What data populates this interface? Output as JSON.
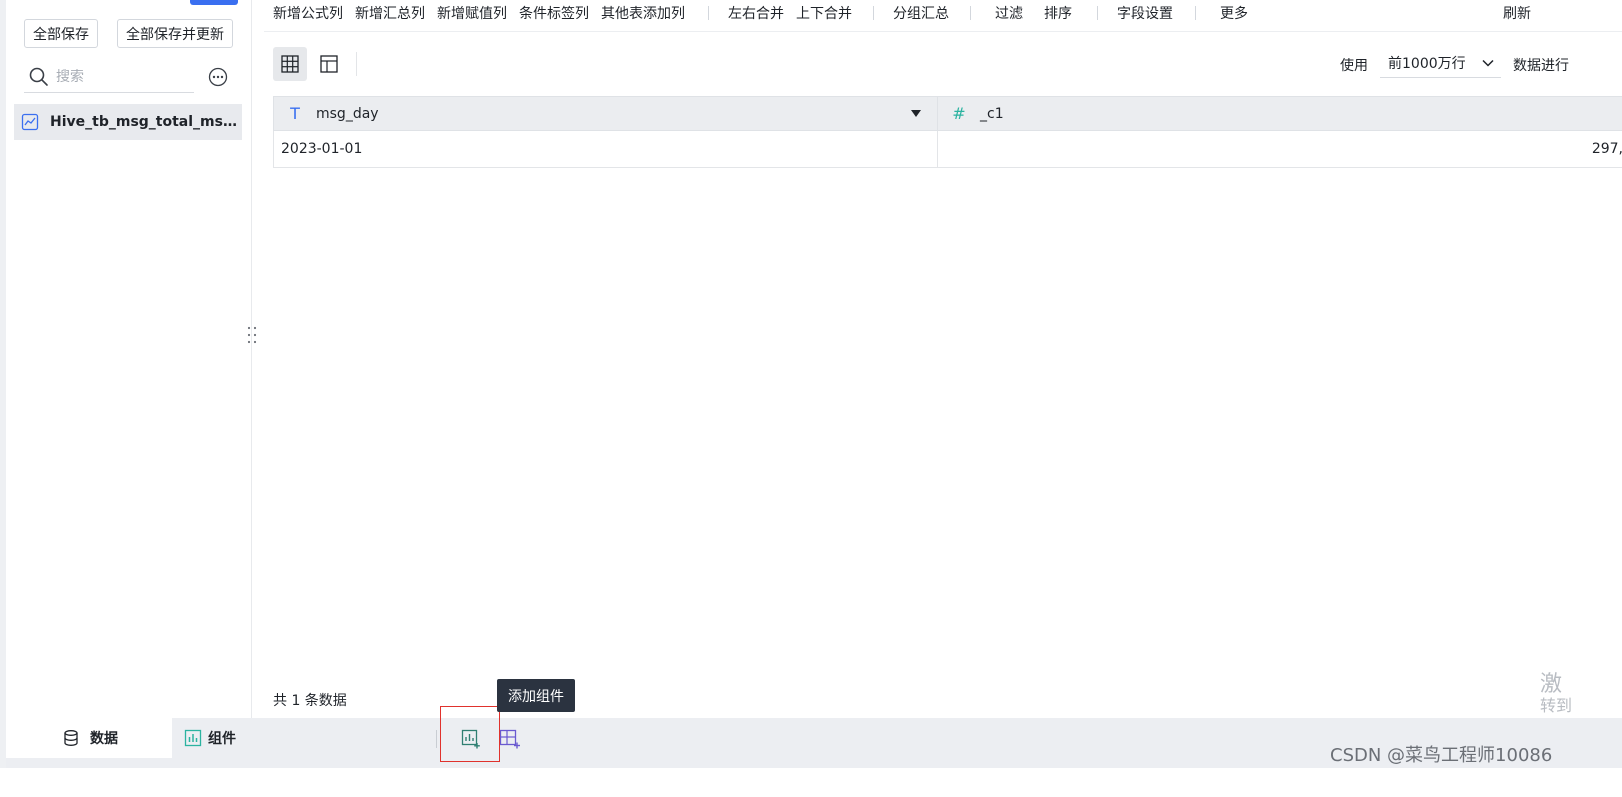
{
  "sidebar": {
    "save_all": "全部保存",
    "save_all_update": "全部保存并更新",
    "search_placeholder": "搜索",
    "dataset_name": "Hive_tb_msg_total_msg_..."
  },
  "toolbar": {
    "add_formula_col": "新增公式列",
    "add_summary_col": "新增汇总列",
    "add_assign_col": "新增赋值列",
    "cond_tag_col": "条件标签列",
    "other_table_col": "其他表添加列",
    "lr_merge": "左右合并",
    "ud_merge": "上下合并",
    "group_summary": "分组汇总",
    "filter": "过滤",
    "sort": "排序",
    "field_settings": "字段设置",
    "more": "更多",
    "refresh": "刷新"
  },
  "view": {
    "use_label": "使用",
    "row_limit": "前1000万行",
    "data_proc": "数据进行"
  },
  "table": {
    "columns": [
      {
        "name": "msg_day",
        "type_icon": "T"
      },
      {
        "name": "_c1",
        "type_icon": "#"
      }
    ],
    "rows": [
      [
        "2023-01-01",
        "297,"
      ]
    ],
    "total": "共 1 条数据"
  },
  "bottom": {
    "tab_data": "数据",
    "tab_component": "组件",
    "tooltip": "添加组件"
  },
  "watermark": "CSDN @菜鸟工程师10086",
  "corner_mark": {
    "line1": "激",
    "line2": "转到"
  },
  "colors": {
    "accent": "#3a6ff0",
    "highlight_box": "#e0322d",
    "tooltip_bg": "#2b3340"
  }
}
